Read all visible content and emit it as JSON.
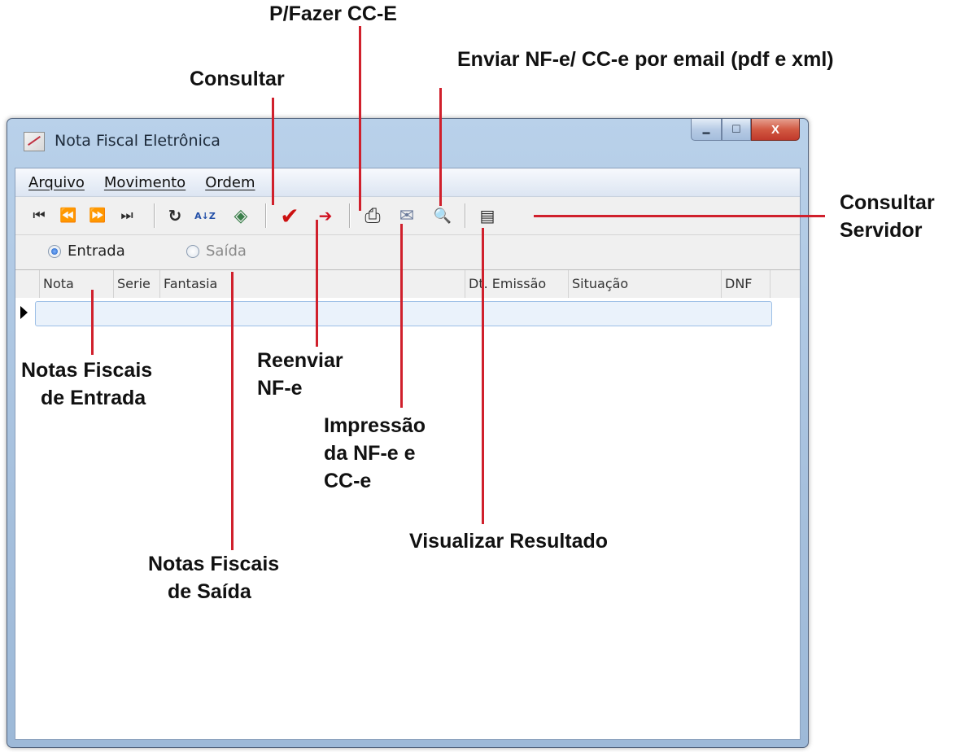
{
  "window": {
    "title": "Nota Fiscal Eletrônica",
    "buttons": {
      "minimize": "▬",
      "maximize": "☐",
      "close": "X"
    }
  },
  "menu": {
    "items": [
      "Arquivo",
      "Movimento",
      "Ordem"
    ]
  },
  "toolbar": {
    "icons": {
      "first": "first-record-icon",
      "prev": "previous-record-icon",
      "next": "next-record-icon",
      "last": "last-record-icon",
      "refresh": "refresh-icon",
      "sort": "sort-az-icon",
      "consult": "consult-icon",
      "resend": "checkmark-icon",
      "cce": "document-arrow-icon",
      "print": "printer-icon",
      "email": "email-icon",
      "view": "magnifier-icon",
      "server": "server-icon"
    },
    "glyphs": {
      "first": "⏮",
      "prev": "⏪",
      "next": "⏩",
      "last": "⏭",
      "refresh": "↻",
      "sort": "A↓Z",
      "consult": "◈",
      "resend": "✔",
      "cce": "➔",
      "print": "⎙",
      "email": "✉",
      "view": "🔍",
      "server": "▤"
    }
  },
  "radios": {
    "entrada": {
      "label": "Entrada",
      "checked": true
    },
    "saida": {
      "label": "Saída",
      "checked": false
    }
  },
  "grid": {
    "columns": [
      "Nota",
      "Serie",
      "Fantasia",
      "Dt. Emissão",
      "Situação",
      "DNF"
    ]
  },
  "annotations": {
    "pfazer": "P/Fazer CC-E",
    "enviar": "Enviar NF-e/ CC-e por email (pdf e xml)",
    "consultar": "Consultar",
    "consultar_servidor": [
      "Consultar",
      "Servidor"
    ],
    "notas_entrada": [
      "Notas Fiscais",
      "de Entrada"
    ],
    "reenviar": [
      "Reenviar",
      "NF-e"
    ],
    "impressao": [
      "Impressão",
      "da NF-e e",
      "CC-e"
    ],
    "visualizar": "Visualizar Resultado",
    "notas_saida": [
      "Notas Fiscais",
      "de Saída"
    ]
  },
  "colors": {
    "annotation_line": "#d0202c",
    "resend_check": "#cc1111"
  }
}
